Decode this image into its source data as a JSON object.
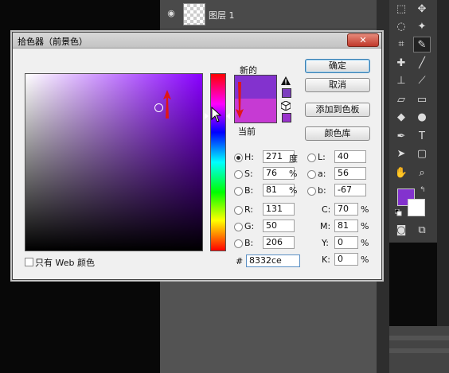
{
  "layers": {
    "layer_name": "图层 1"
  },
  "dialog": {
    "title": "拾色器（前景色）",
    "close_label": "✕",
    "new_label": "新的",
    "current_label": "当前",
    "buttons": {
      "ok": "确定",
      "cancel": "取消",
      "add_to_swatches": "添加到色板",
      "color_libraries": "颜色库"
    },
    "only_web_colors": "只有 Web 颜色",
    "hsb": {
      "h": {
        "label": "H:",
        "value": "271",
        "unit": "度"
      },
      "s": {
        "label": "S:",
        "value": "76",
        "unit": "%"
      },
      "b": {
        "label": "B:",
        "value": "81",
        "unit": "%"
      }
    },
    "rgb": {
      "r": {
        "label": "R:",
        "value": "131"
      },
      "g": {
        "label": "G:",
        "value": "50"
      },
      "b": {
        "label": "B:",
        "value": "206"
      }
    },
    "lab": {
      "l": {
        "label": "L:",
        "value": "40"
      },
      "a": {
        "label": "a:",
        "value": "56"
      },
      "b": {
        "label": "b:",
        "value": "-67"
      }
    },
    "cmyk": {
      "c": {
        "label": "C:",
        "value": "70",
        "unit": "%"
      },
      "m": {
        "label": "M:",
        "value": "81",
        "unit": "%"
      },
      "y": {
        "label": "Y:",
        "value": "0",
        "unit": "%"
      },
      "k": {
        "label": "K:",
        "value": "0",
        "unit": "%"
      }
    },
    "hex_label": "#",
    "hex_value": "8332ce"
  },
  "colors": {
    "new": "#8332ce",
    "current": "#c63ad3",
    "foreground": "#8332ce",
    "background": "#ffffff"
  },
  "icons": [
    "eye-icon",
    "gamut-warning-icon",
    "web-cube-icon",
    "close-icon"
  ]
}
